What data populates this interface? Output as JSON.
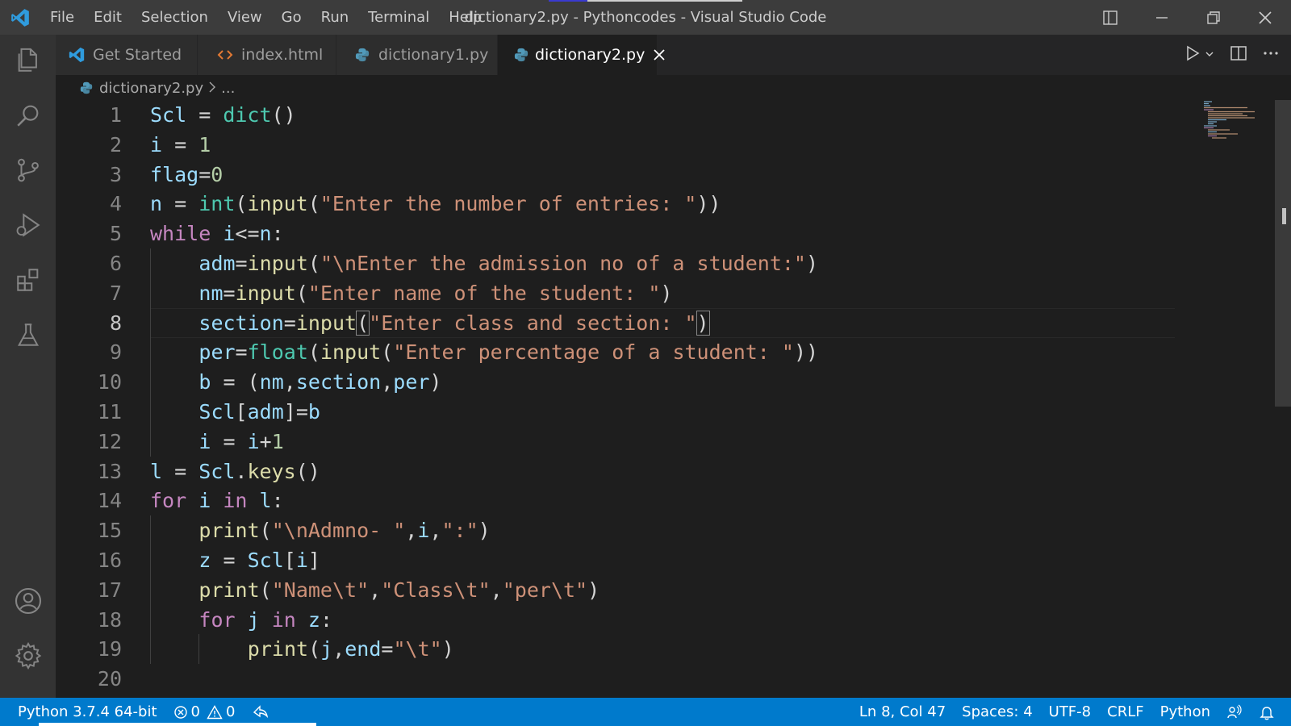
{
  "window": {
    "title": "dictionary2.py - Pythoncodes - Visual Studio Code",
    "menu": [
      "File",
      "Edit",
      "Selection",
      "View",
      "Go",
      "Run",
      "Terminal",
      "Help"
    ]
  },
  "activity_bar": {
    "items": [
      "explorer-icon",
      "search-icon",
      "source-control-icon",
      "run-debug-icon",
      "extensions-icon",
      "testing-icon"
    ],
    "bottom": [
      "account-icon",
      "settings-gear-icon"
    ]
  },
  "tabs": [
    {
      "label": "Get Started",
      "icon": "vscode-icon",
      "active": false
    },
    {
      "label": "index.html",
      "icon": "html-icon",
      "active": false
    },
    {
      "label": "dictionary1.py",
      "icon": "python-icon",
      "active": false
    },
    {
      "label": "dictionary2.py",
      "icon": "python-icon",
      "active": true
    }
  ],
  "breadcrumb": {
    "file": "dictionary2.py",
    "rest": "..."
  },
  "editor": {
    "current_line": 8,
    "lines": [
      {
        "n": "1",
        "indent": 0,
        "tokens": [
          [
            "var",
            "Scl"
          ],
          [
            "op",
            " = "
          ],
          [
            "builtin",
            "dict"
          ],
          [
            "op",
            "()"
          ]
        ]
      },
      {
        "n": "2",
        "indent": 0,
        "tokens": [
          [
            "var",
            "i"
          ],
          [
            "op",
            " = "
          ],
          [
            "num",
            "1"
          ]
        ]
      },
      {
        "n": "3",
        "indent": 0,
        "tokens": [
          [
            "var",
            "flag"
          ],
          [
            "op",
            "="
          ],
          [
            "num",
            "0"
          ]
        ]
      },
      {
        "n": "4",
        "indent": 0,
        "tokens": [
          [
            "var",
            "n"
          ],
          [
            "op",
            " = "
          ],
          [
            "builtin",
            "int"
          ],
          [
            "op",
            "("
          ],
          [
            "fn",
            "input"
          ],
          [
            "op",
            "("
          ],
          [
            "str",
            "\"Enter the number of entries: \""
          ],
          [
            "op",
            "))"
          ]
        ]
      },
      {
        "n": "5",
        "indent": 0,
        "tokens": [
          [
            "kw",
            "while"
          ],
          [
            "op",
            " "
          ],
          [
            "var",
            "i"
          ],
          [
            "op",
            "<="
          ],
          [
            "var",
            "n"
          ],
          [
            "op",
            ":"
          ]
        ]
      },
      {
        "n": "6",
        "indent": 1,
        "tokens": [
          [
            "var",
            "adm"
          ],
          [
            "op",
            "="
          ],
          [
            "fn",
            "input"
          ],
          [
            "op",
            "("
          ],
          [
            "str",
            "\"\\nEnter the admission no of a student:\""
          ],
          [
            "op",
            ")"
          ]
        ]
      },
      {
        "n": "7",
        "indent": 1,
        "tokens": [
          [
            "var",
            "nm"
          ],
          [
            "op",
            "="
          ],
          [
            "fn",
            "input"
          ],
          [
            "op",
            "("
          ],
          [
            "str",
            "\"Enter name of the student: \""
          ],
          [
            "op",
            ")"
          ]
        ]
      },
      {
        "n": "8",
        "indent": 1,
        "tokens": [
          [
            "var",
            "section"
          ],
          [
            "op",
            "="
          ],
          [
            "fn",
            "input"
          ],
          [
            "hl",
            "("
          ],
          [
            "str",
            "\"Enter class and section: \""
          ],
          [
            "hl",
            ")"
          ]
        ]
      },
      {
        "n": "9",
        "indent": 1,
        "tokens": [
          [
            "var",
            "per"
          ],
          [
            "op",
            "="
          ],
          [
            "builtin",
            "float"
          ],
          [
            "op",
            "("
          ],
          [
            "fn",
            "input"
          ],
          [
            "op",
            "("
          ],
          [
            "str",
            "\"Enter percentage of a student: \""
          ],
          [
            "op",
            "))"
          ]
        ]
      },
      {
        "n": "10",
        "indent": 1,
        "tokens": [
          [
            "var",
            "b"
          ],
          [
            "op",
            " = ("
          ],
          [
            "var",
            "nm"
          ],
          [
            "op",
            ","
          ],
          [
            "var",
            "section"
          ],
          [
            "op",
            ","
          ],
          [
            "var",
            "per"
          ],
          [
            "op",
            ")"
          ]
        ]
      },
      {
        "n": "11",
        "indent": 1,
        "tokens": [
          [
            "var",
            "Scl"
          ],
          [
            "op",
            "["
          ],
          [
            "var",
            "adm"
          ],
          [
            "op",
            "]="
          ],
          [
            "var",
            "b"
          ]
        ]
      },
      {
        "n": "12",
        "indent": 1,
        "tokens": [
          [
            "var",
            "i"
          ],
          [
            "op",
            " = "
          ],
          [
            "var",
            "i"
          ],
          [
            "op",
            "+"
          ],
          [
            "num",
            "1"
          ]
        ]
      },
      {
        "n": "13",
        "indent": 0,
        "tokens": [
          [
            "var",
            "l"
          ],
          [
            "op",
            " = "
          ],
          [
            "var",
            "Scl"
          ],
          [
            "op",
            "."
          ],
          [
            "fn",
            "keys"
          ],
          [
            "op",
            "()"
          ]
        ]
      },
      {
        "n": "14",
        "indent": 0,
        "tokens": [
          [
            "kw",
            "for"
          ],
          [
            "op",
            " "
          ],
          [
            "var",
            "i"
          ],
          [
            "op",
            " "
          ],
          [
            "kw",
            "in"
          ],
          [
            "op",
            " "
          ],
          [
            "var",
            "l"
          ],
          [
            "op",
            ":"
          ]
        ]
      },
      {
        "n": "15",
        "indent": 1,
        "tokens": [
          [
            "fn",
            "print"
          ],
          [
            "op",
            "("
          ],
          [
            "str",
            "\"\\nAdmno- \""
          ],
          [
            "op",
            ","
          ],
          [
            "var",
            "i"
          ],
          [
            "op",
            ","
          ],
          [
            "str",
            "\":\""
          ],
          [
            "op",
            ")"
          ]
        ]
      },
      {
        "n": "16",
        "indent": 1,
        "tokens": [
          [
            "var",
            "z"
          ],
          [
            "op",
            " = "
          ],
          [
            "var",
            "Scl"
          ],
          [
            "op",
            "["
          ],
          [
            "var",
            "i"
          ],
          [
            "op",
            "]"
          ]
        ]
      },
      {
        "n": "17",
        "indent": 1,
        "tokens": [
          [
            "fn",
            "print"
          ],
          [
            "op",
            "("
          ],
          [
            "str",
            "\"Name\\t\""
          ],
          [
            "op",
            ","
          ],
          [
            "str",
            "\"Class\\t\""
          ],
          [
            "op",
            ","
          ],
          [
            "str",
            "\"per\\t\""
          ],
          [
            "op",
            ")"
          ]
        ]
      },
      {
        "n": "18",
        "indent": 1,
        "tokens": [
          [
            "kw",
            "for"
          ],
          [
            "op",
            " "
          ],
          [
            "var",
            "j"
          ],
          [
            "op",
            " "
          ],
          [
            "kw",
            "in"
          ],
          [
            "op",
            " "
          ],
          [
            "var",
            "z"
          ],
          [
            "op",
            ":"
          ]
        ]
      },
      {
        "n": "19",
        "indent": 2,
        "tokens": [
          [
            "fn",
            "print"
          ],
          [
            "op",
            "("
          ],
          [
            "var",
            "j"
          ],
          [
            "op",
            ","
          ],
          [
            "var",
            "end"
          ],
          [
            "op",
            "="
          ],
          [
            "str",
            "\"\\t\""
          ],
          [
            "op",
            ")"
          ]
        ]
      },
      {
        "n": "20",
        "indent": 0,
        "tokens": []
      }
    ]
  },
  "statusbar": {
    "interpreter": "Python 3.7.4 64-bit",
    "errors": "0",
    "warnings": "0",
    "position": "Ln 8, Col 47",
    "spaces": "Spaces: 4",
    "encoding": "UTF-8",
    "eol": "CRLF",
    "language": "Python"
  },
  "colors": {
    "statusbar": "#007acc",
    "titlebar": "#3c3c3c",
    "activitybar": "#333333",
    "editor_bg": "#1e1e1e"
  }
}
